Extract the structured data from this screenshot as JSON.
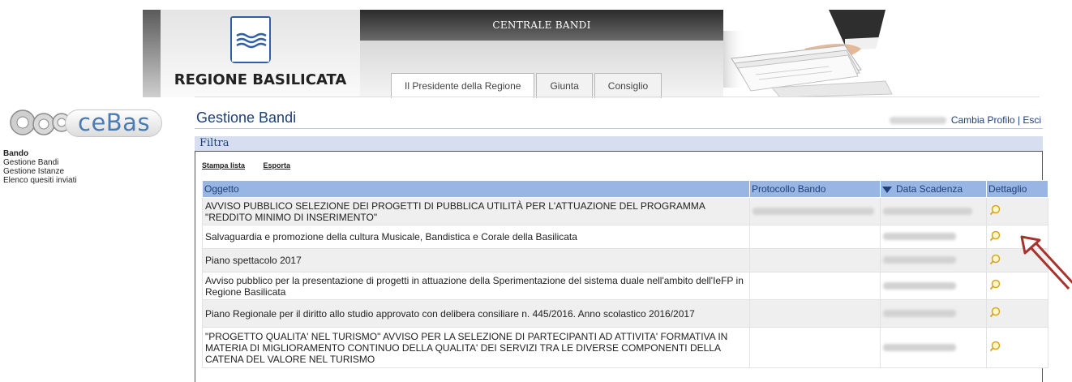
{
  "header": {
    "banner_title": "CENTRALE BANDI",
    "region_name": "REGIONE BASILICATA",
    "tabs": [
      {
        "label": "Il Presidente della Regione"
      },
      {
        "label": "Giunta"
      },
      {
        "label": "Consiglio"
      }
    ]
  },
  "sidebar": {
    "logo_text": "ceBas",
    "section_title": "Bando",
    "items": [
      {
        "label": "Gestione Bandi"
      },
      {
        "label": "Gestione Istanze"
      },
      {
        "label": "Elenco quesiti inviati"
      }
    ]
  },
  "main": {
    "page_title": "Gestione Bandi",
    "cambia_profilo": "Cambia Profilo",
    "separator": "|",
    "esci": "Esci",
    "filter_label": "Filtra",
    "actions": {
      "print": "Stampa lista",
      "export": "Esporta"
    },
    "table": {
      "columns": [
        "Oggetto",
        "Protocollo Bando",
        "Data Scadenza",
        "Dettaglio"
      ],
      "sort_icon": "triangle-down-icon",
      "rows": [
        {
          "oggetto": "AVVISO PUBBLICO SELEZIONE DEI PROGETTI DI PUBBLICA UTILITÀ PER L'ATTUAZIONE DEL PROGRAMMA \"REDDITO MINIMO DI INSERIMENTO\"",
          "protocollo_redacted": true
        },
        {
          "oggetto": "Salvaguardia e promozione della cultura Musicale, Bandistica e Corale della Basilicata",
          "protocollo_redacted": false
        },
        {
          "oggetto": "Piano spettacolo 2017",
          "protocollo_redacted": false
        },
        {
          "oggetto": "Avviso pubblico per la presentazione di progetti in attuazione della Sperimentazione del sistema duale nell'ambito dell'IeFP in Regione Basilicata",
          "protocollo_redacted": false
        },
        {
          "oggetto": "Piano Regionale per il diritto allo studio approvato con delibera consiliare n. 445/2016. Anno scolastico 2016/2017",
          "protocollo_redacted": false
        },
        {
          "oggetto": "\"PROGETTO QUALITA' NEL TURISMO\" AVVISO PER LA SELEZIONE DI PARTECIPANTI AD ATTIVITA' FORMATIVA IN MATERIA DI MIGLIORAMENTO CONTINUO DELLA QUALITA' DEI SERVIZI TRA LE DIVERSE COMPONENTI DELLA CATENA DEL VALORE NEL TURISMO",
          "protocollo_redacted": false
        }
      ]
    }
  },
  "colors": {
    "title_blue": "#1d3f7a",
    "header_row": "#99b5e3",
    "filter_bar": "#d6def0",
    "arrow_red": "#a8322c"
  }
}
